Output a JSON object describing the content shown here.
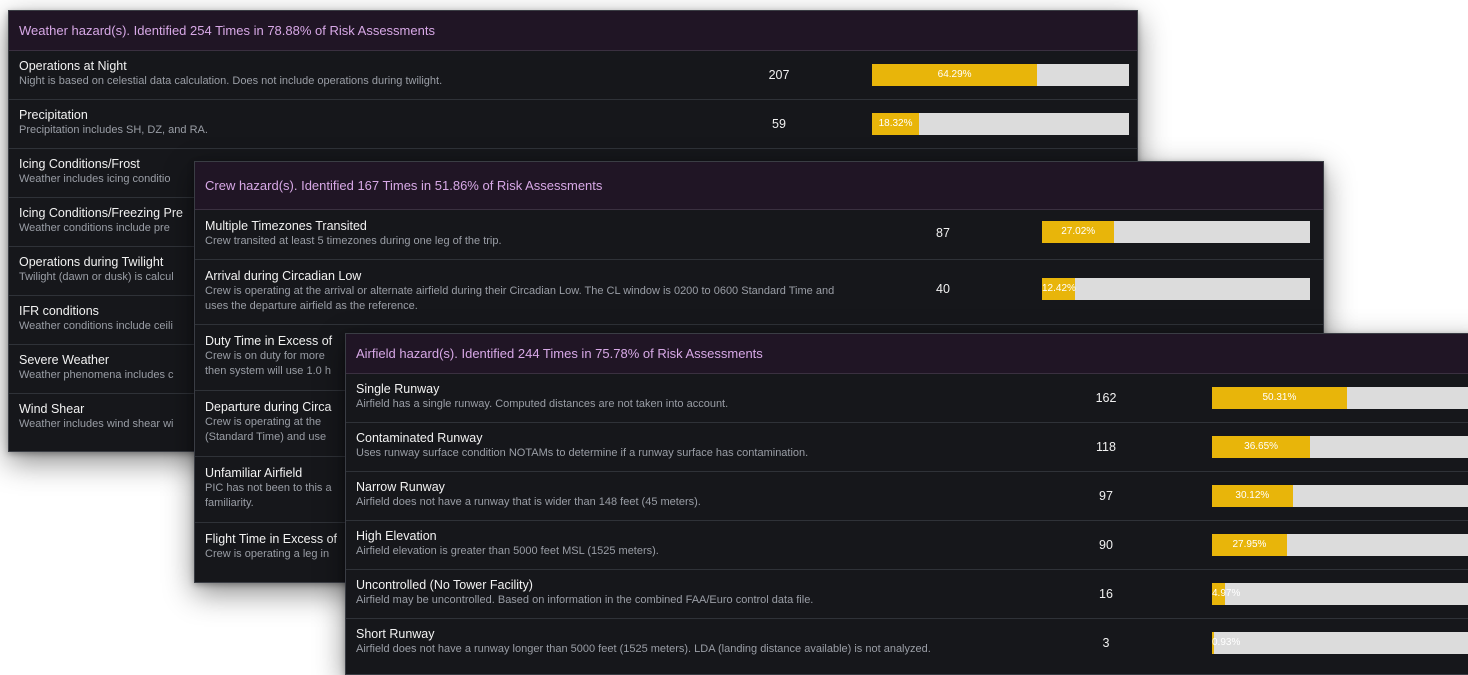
{
  "weather": {
    "header": "Weather hazard(s). Identified 254 Times in 78.88% of Risk Assessments",
    "rows": [
      {
        "title": "Operations at Night",
        "desc": "Night is based on celestial data calculation. Does not include operations during twilight.",
        "count": "207",
        "pct_label": "64.29%",
        "pct": 64.29
      },
      {
        "title": "Precipitation",
        "desc": "Precipitation includes SH, DZ, and RA.",
        "count": "59",
        "pct_label": "18.32%",
        "pct": 18.32
      },
      {
        "title": "Icing Conditions/Frost",
        "desc": "Weather includes icing conditio"
      },
      {
        "title": "Icing Conditions/Freezing Pre",
        "desc": "Weather conditions include pre"
      },
      {
        "title": "Operations during Twilight",
        "desc": "Twilight (dawn or dusk) is calcul"
      },
      {
        "title": "IFR conditions",
        "desc": "Weather conditions include ceili"
      },
      {
        "title": "Severe Weather",
        "desc": "Weather phenomena includes c"
      },
      {
        "title": "Wind Shear",
        "desc": "Weather includes wind shear wi"
      }
    ]
  },
  "crew": {
    "header": "Crew hazard(s). Identified 167 Times in 51.86% of Risk Assessments",
    "rows": [
      {
        "title": "Multiple Timezones Transited",
        "desc": "Crew transited at least 5 timezones during one leg of the trip.",
        "count": "87",
        "pct_label": "27.02%",
        "pct": 27.02
      },
      {
        "title": "Arrival during Circadian Low",
        "desc": "Crew is operating at the arrival or alternate airfield during their Circadian Low. The CL window is 0200 to 0600 Standard Time and uses the departure airfield as the reference.",
        "count": "40",
        "pct_label": "12.42%",
        "pct": 12.42
      },
      {
        "title": "Duty Time in Excess of",
        "desc": "Crew is on duty for more then system will use 1.0 h"
      },
      {
        "title": "Departure during Circa",
        "desc": "Crew is operating at the (Standard Time) and use"
      },
      {
        "title": "Unfamiliar Airfield",
        "desc": "PIC has not been to this a familiarity."
      },
      {
        "title": "Flight Time in Excess of",
        "desc": "Crew is operating a leg in"
      }
    ]
  },
  "airfield": {
    "header": "Airfield hazard(s). Identified 244 Times in 75.78% of Risk Assessments",
    "rows": [
      {
        "title": "Single Runway",
        "desc": "Airfield has a single runway. Computed distances are not taken into account.",
        "count": "162",
        "pct_label": "50.31%",
        "pct": 50.31
      },
      {
        "title": "Contaminated Runway",
        "desc": "Uses runway surface condition NOTAMs to determine if a runway surface has contamination.",
        "count": "118",
        "pct_label": "36.65%",
        "pct": 36.65
      },
      {
        "title": "Narrow Runway",
        "desc": "Airfield does not have a runway that is wider than 148 feet (45 meters).",
        "count": "97",
        "pct_label": "30.12%",
        "pct": 30.12
      },
      {
        "title": "High Elevation",
        "desc": "Airfield elevation is greater than 5000 feet MSL (1525 meters).",
        "count": "90",
        "pct_label": "27.95%",
        "pct": 27.95
      },
      {
        "title": "Uncontrolled (No Tower Facility)",
        "desc": "Airfield may be uncontrolled. Based on information in the combined FAA/Euro control data file.",
        "count": "16",
        "pct_label": "4.97%",
        "pct": 4.97
      },
      {
        "title": "Short Runway",
        "desc": "Airfield does not have a runway longer than 5000 feet (1525 meters). LDA (landing distance available) is not analyzed.",
        "count": "3",
        "pct_label": "0.93%",
        "pct": 0.93
      }
    ]
  },
  "colors": {
    "bar_fill": "#e8b50a",
    "bar_track": "#dcdcdc",
    "header_text": "#d7a8e6",
    "panel_bg": "#16171b"
  }
}
